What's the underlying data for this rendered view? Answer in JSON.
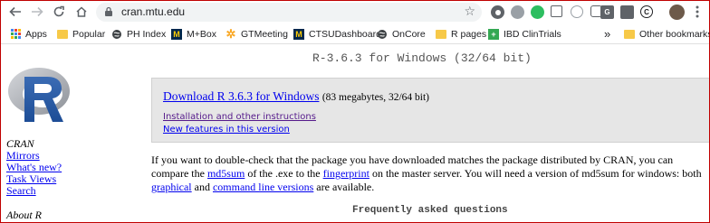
{
  "browser": {
    "url": "cran.mtu.edu",
    "icons": {
      "back": "arrow-left-icon",
      "forward": "arrow-right-icon",
      "reload": "reload-icon",
      "home": "home-icon",
      "lock": "lock-icon",
      "bookmark_star": "star-icon"
    },
    "extension_letters": {
      "g": "G",
      "c": "C"
    },
    "bookmarks": {
      "apps": "Apps",
      "popular": "Popular",
      "ph_index": "PH Index",
      "mbox": "M+Box",
      "gtmeeting": "GTMeeting",
      "ctsu": "CTSUDashboard",
      "oncore": "OnCore",
      "rpages": "R pages",
      "ibd": "IBD ClinTrials",
      "overflow": "»",
      "other": "Other bookmarks"
    },
    "colors": {
      "folder": "#f7c948",
      "umich_blue": "#00274c",
      "umich_maize": "#ffcb05",
      "border_red": "#c00000"
    }
  },
  "sidebar": {
    "cran_heading": "CRAN",
    "links": {
      "mirrors": "Mirrors",
      "whats_new": "What's new?",
      "task_views": "Task Views",
      "search": "Search"
    },
    "about_heading": "About R"
  },
  "main": {
    "title": "R-3.6.3 for Windows (32/64 bit)",
    "download": {
      "link_text": "Download R 3.6.3 for Windows",
      "size_text": "(83 megabytes, 32/64 bit)",
      "install_link": "Installation and other instructions",
      "features_link": "New features in this version"
    },
    "paragraph": {
      "t1": "If you want to double-check that the package you have downloaded matches the package distributed by CRAN, you can compare the ",
      "md5sum": "md5sum",
      "t2": " of the .exe to the ",
      "fingerprint": "fingerprint",
      "t3": " on the master server. You will need a version of md5sum for windows: both ",
      "graphical": "graphical",
      "t4": " and ",
      "command_line": "command line versions",
      "t5": " are available."
    },
    "faq_heading": "Frequently asked questions"
  }
}
